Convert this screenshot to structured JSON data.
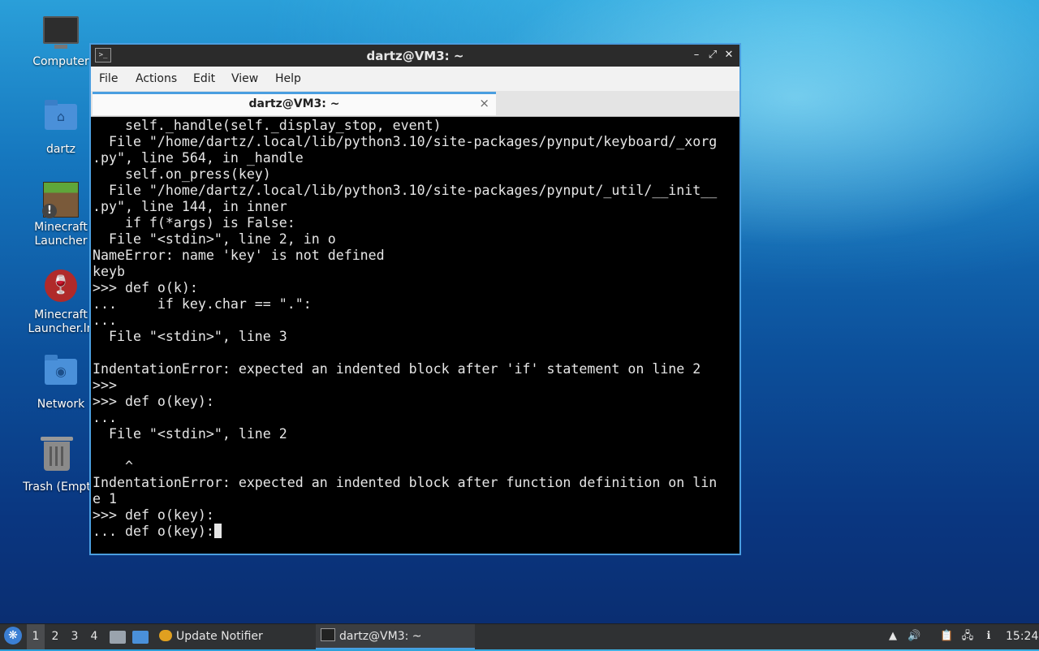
{
  "desktop": {
    "icons": [
      {
        "label": "Computer"
      },
      {
        "label": "dartz"
      },
      {
        "label": "Minecraft\nLauncher"
      },
      {
        "label": "Minecraft\nLauncher.ln"
      },
      {
        "label": "Network"
      },
      {
        "label": "Trash (Empt"
      }
    ]
  },
  "window": {
    "title": "dartz@VM3: ~",
    "controls": {
      "minimize": "–",
      "maximize": "⤢",
      "close": "✕"
    },
    "menu": [
      "File",
      "Actions",
      "Edit",
      "View",
      "Help"
    ],
    "tab": {
      "label": "dartz@VM3: ~",
      "close": "×"
    },
    "terminal_text": "    self._handle(self._display_stop, event)\n  File \"/home/dartz/.local/lib/python3.10/site-packages/pynput/keyboard/_xorg\n.py\", line 564, in _handle\n    self.on_press(key)\n  File \"/home/dartz/.local/lib/python3.10/site-packages/pynput/_util/__init__\n.py\", line 144, in inner\n    if f(*args) is False:\n  File \"<stdin>\", line 2, in o\nNameError: name 'key' is not defined\nkeyb\n>>> def o(k):\n...     if key.char == \".\":\n...\n  File \"<stdin>\", line 3\n\nIndentationError: expected an indented block after 'if' statement on line 2\n>>>\n>>> def o(key):\n...\n  File \"<stdin>\", line 2\n\n    ^\nIndentationError: expected an indented block after function definition on lin\ne 1\n>>> def o(key):\n... def o(key):"
  },
  "taskbar": {
    "workspaces": [
      "1",
      "2",
      "3",
      "4"
    ],
    "tasks": [
      {
        "label": "Update Notifier",
        "icon": "update-icon"
      },
      {
        "label": "dartz@VM3: ~",
        "icon": "terminal-icon"
      }
    ],
    "clock": "15:24"
  },
  "colors": {
    "accent": "#4a9ee0",
    "terminal_bg": "#000000",
    "terminal_fg": "#e6e6e6",
    "taskbar_bg": "#2f3133"
  }
}
